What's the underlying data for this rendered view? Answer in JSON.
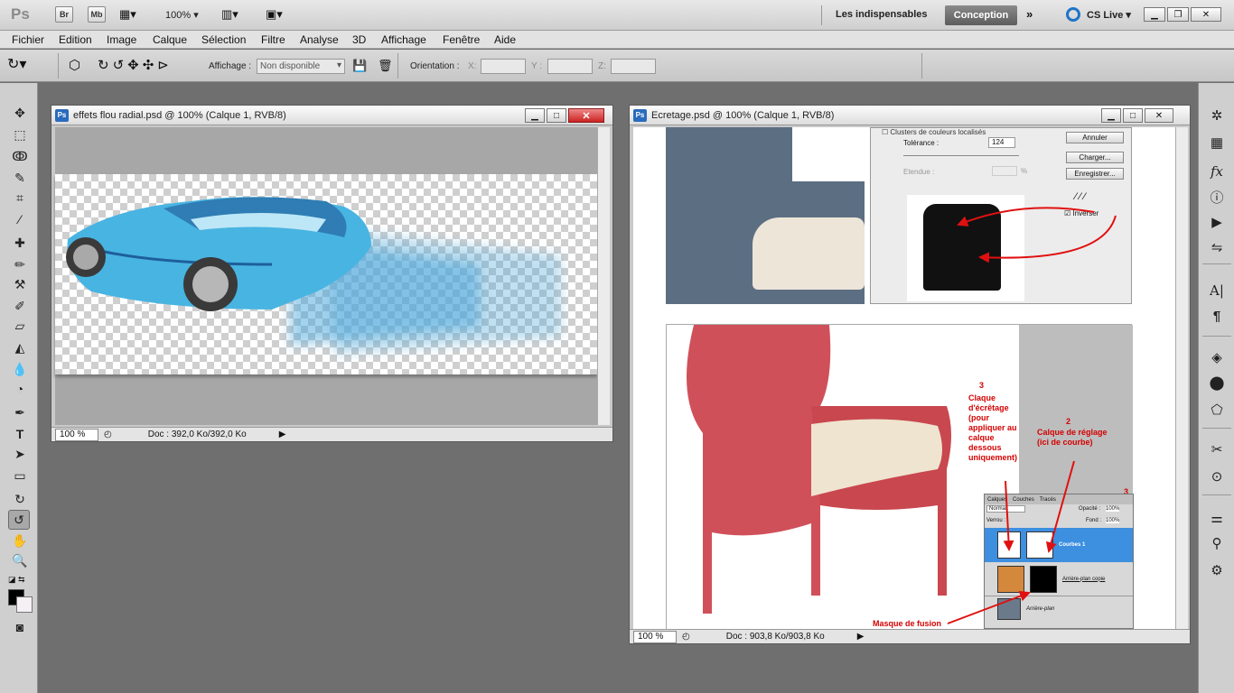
{
  "app": {
    "logo": "Ps",
    "bridge": "Br",
    "minibridge": "Mb",
    "zoom": "100%",
    "workspace_essentials": "Les indispensables",
    "workspace_active": "Conception",
    "cslive": "CS Live"
  },
  "menu": [
    "Fichier",
    "Edition",
    "Image",
    "Calque",
    "Sélection",
    "Filtre",
    "Analyse",
    "3D",
    "Affichage",
    "Fenêtre",
    "Aide"
  ],
  "options": {
    "affichage_label": "Affichage :",
    "affichage_value": "Non disponible",
    "orientation_label": "Orientation :",
    "x_label": "X:",
    "y_label": "Y :",
    "z_label": "Z:"
  },
  "doc1": {
    "badge": "Ps",
    "title": "effets flou radial.psd @ 100% (Calque 1, RVB/8)",
    "zoom": "100 %",
    "docinfo": "Doc : 392,0 Ko/392,0 Ko"
  },
  "doc2": {
    "badge": "Ps",
    "title": "Ecretage.psd @ 100% (Calque 1, RVB/8)",
    "zoom": "100 %",
    "docinfo": "Doc : 903,8 Ko/903,8 Ko",
    "dialog": {
      "clusters": "Clusters de couleurs localisés",
      "tolerance_label": "Tolérance :",
      "tolerance_value": "124",
      "etendue_label": "Etendue :",
      "percent": "%",
      "annuler": "Annuler",
      "charger": "Charger...",
      "enregistrer": "Enregistrer...",
      "inverser": "Inverser"
    },
    "layers": {
      "tabs": [
        "Calques",
        "Couches",
        "Tracés"
      ],
      "mode": "Normal",
      "opacite_label": "Opacité :",
      "opacite_value": "100%",
      "verrou": "Verrou :",
      "fond_label": "Fond :",
      "fond_value": "100%",
      "rows": [
        "Courbes 1",
        "Arrière-plan copie",
        "Arrière-plan"
      ]
    },
    "annotations": {
      "num3": "3",
      "claque": "Claque d'écrêtage (pour appliquer au calque dessous uniquement)",
      "num2": "2",
      "calque_reglage": "Calque de réglage (ici de courbe)",
      "masque": "Masque de fusion",
      "num3b": "3"
    }
  }
}
